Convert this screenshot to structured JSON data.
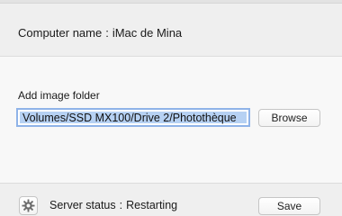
{
  "computer": {
    "label": "Computer name",
    "separator": ":",
    "value": "iMac de Mina"
  },
  "image_folder": {
    "label": "Add image folder",
    "path_value": "Volumes/SSD MX100/Drive 2/Photothèque",
    "browse_label": "Browse"
  },
  "footer": {
    "settings_icon": "gear-icon",
    "status_label": "Server status",
    "separator": ":",
    "status_value": "Restarting",
    "save_label": "Save"
  },
  "colors": {
    "selection": "#b6d1f3",
    "focus_ring": "#8fb3e8"
  }
}
